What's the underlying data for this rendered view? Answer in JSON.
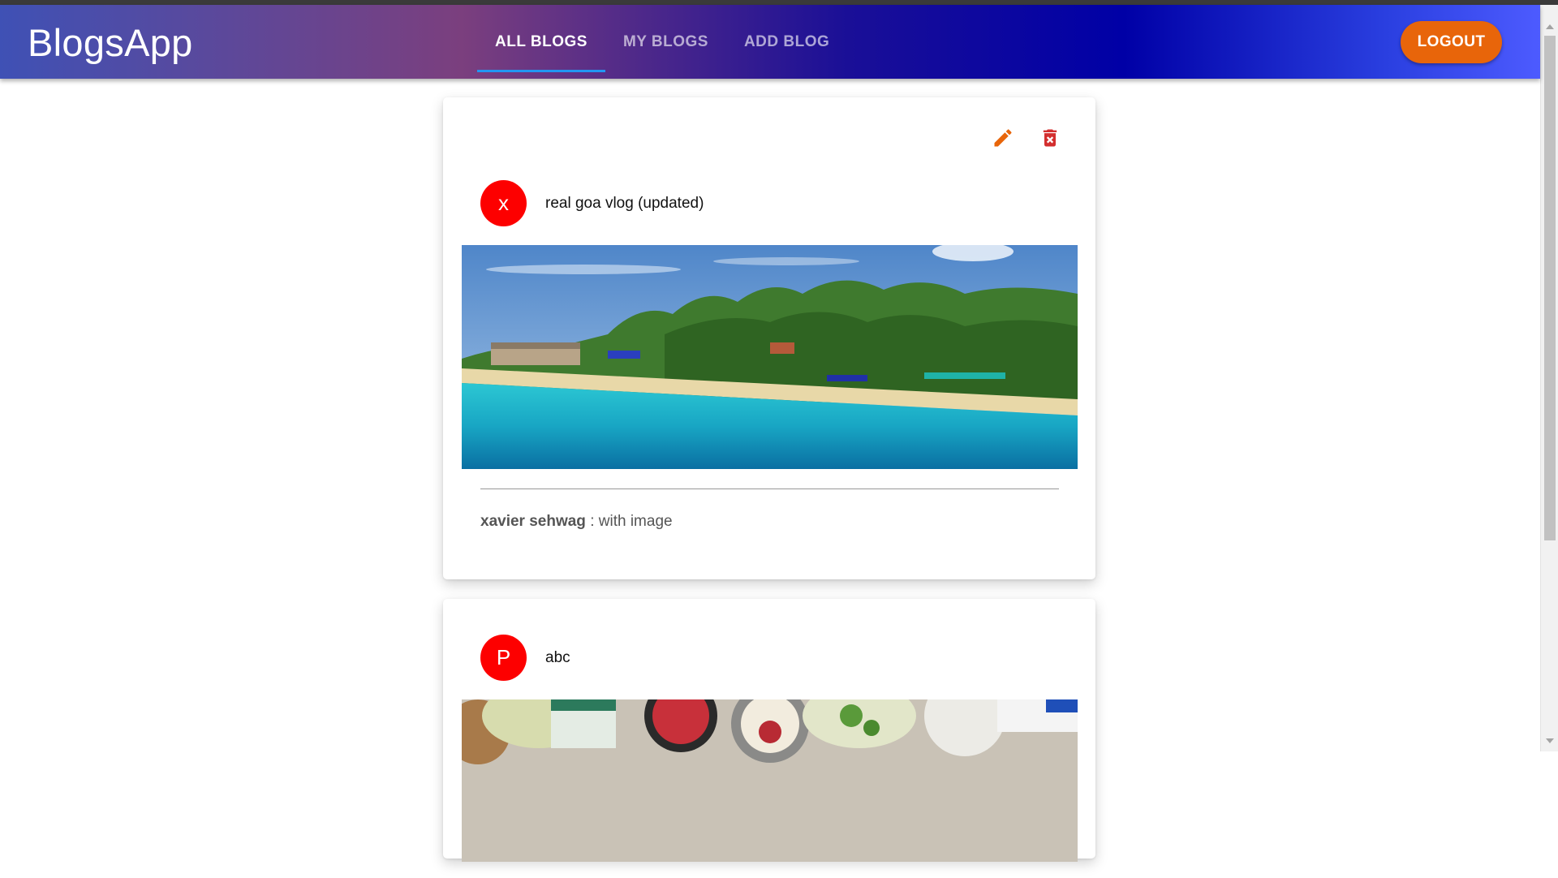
{
  "app": {
    "title": "BlogsApp"
  },
  "nav": {
    "tabs": [
      {
        "label": "ALL BLOGS",
        "active": true
      },
      {
        "label": "MY BLOGS",
        "active": false
      },
      {
        "label": "ADD BLOG",
        "active": false
      }
    ],
    "logout_label": "LOGOUT"
  },
  "colors": {
    "appbar_gradient": [
      "#3f51b5",
      "#7b3f7e",
      "#0000a6",
      "#4d5bff"
    ],
    "logout": "#e8650a",
    "avatar": "#fd0000",
    "edit_icon": "#e8650a",
    "delete_icon": "#d32f2f",
    "active_tab_indicator": "#2196f3"
  },
  "blogs": [
    {
      "avatar_letter": "x",
      "title": "real goa vlog (updated)",
      "image": "goa-beach",
      "author": "xavier sehwag",
      "separator": " : ",
      "description": "with image",
      "actions": [
        "edit-icon",
        "delete-icon"
      ]
    },
    {
      "avatar_letter": "P",
      "title": "abc",
      "image": "food-table"
    }
  ]
}
